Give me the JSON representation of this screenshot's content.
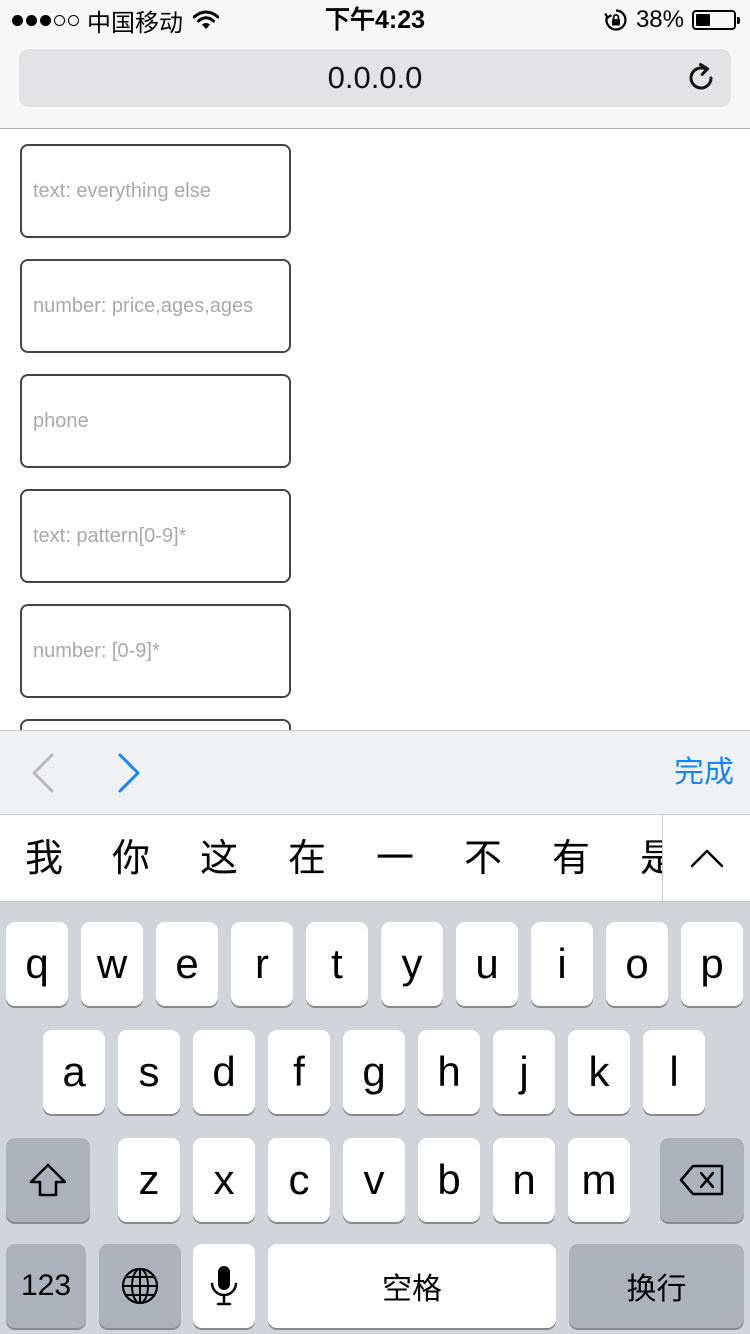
{
  "status_bar": {
    "carrier": "中国移动",
    "time": "下午4:23",
    "battery_percent": "38%",
    "battery_level": 0.38,
    "signal_bars_filled": 3,
    "signal_bars_total": 5
  },
  "browser": {
    "url": "0.0.0.0"
  },
  "form": {
    "fields": [
      {
        "placeholder": "text: everything else",
        "type": "text"
      },
      {
        "placeholder": "number: price,ages,ages",
        "type": "number"
      },
      {
        "placeholder": "phone",
        "type": "tel"
      },
      {
        "placeholder": "text: pattern[0-9]*",
        "type": "text"
      },
      {
        "placeholder": "number: [0-9]*",
        "type": "number"
      }
    ]
  },
  "accessory": {
    "done_label": "完成"
  },
  "candidates": [
    "我",
    "你",
    "这",
    "在",
    "一",
    "不",
    "有",
    "是"
  ],
  "keyboard": {
    "row1": [
      "q",
      "w",
      "e",
      "r",
      "t",
      "y",
      "u",
      "i",
      "o",
      "p"
    ],
    "row2": [
      "a",
      "s",
      "d",
      "f",
      "g",
      "h",
      "j",
      "k",
      "l"
    ],
    "row3": [
      "z",
      "x",
      "c",
      "v",
      "b",
      "n",
      "m"
    ],
    "numbers_label": "123",
    "space_label": "空格",
    "return_label": "换行"
  },
  "colors": {
    "accent": "#1a82fb",
    "keyboard_bg": "#d1d4da",
    "key_dark": "#acb2bb"
  }
}
